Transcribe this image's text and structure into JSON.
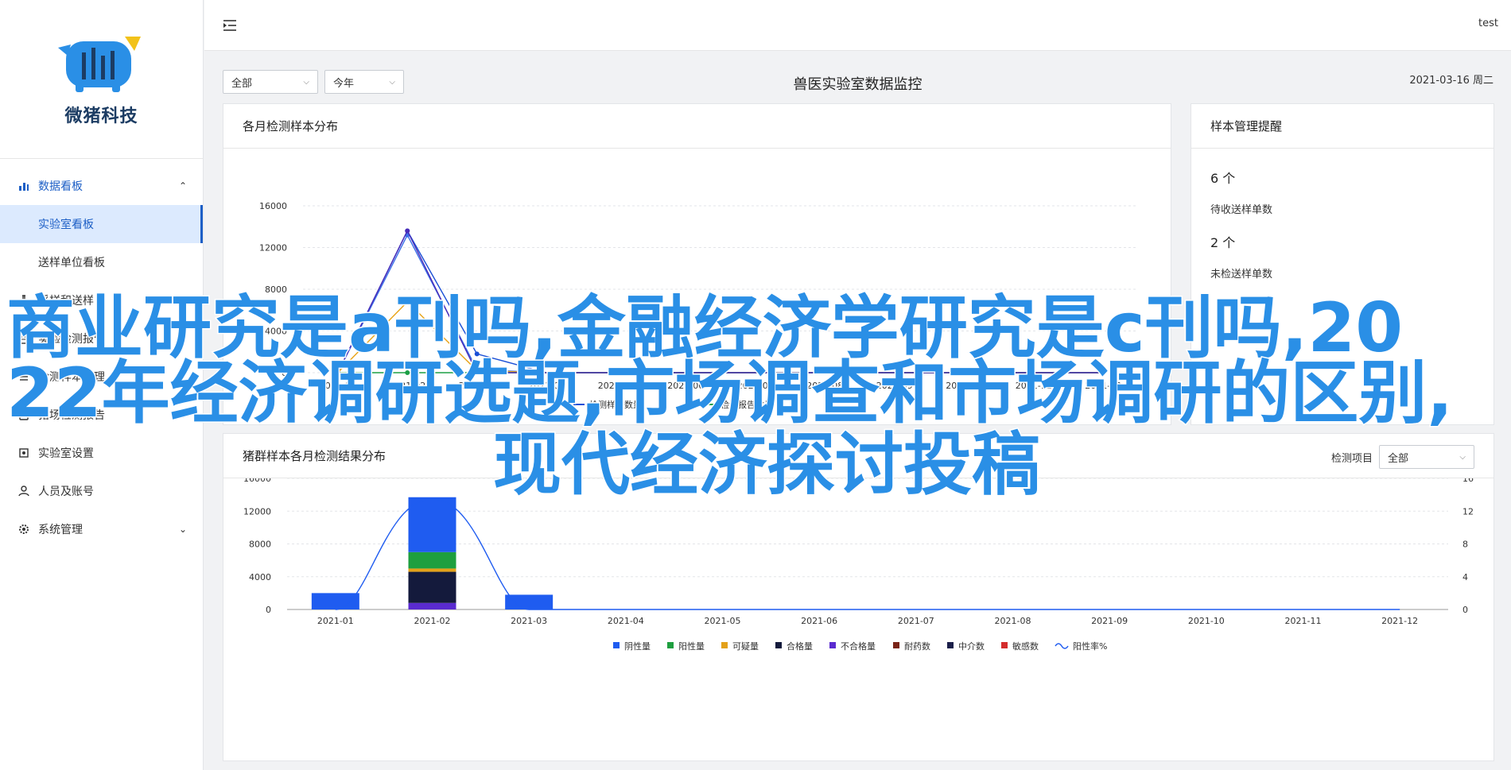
{
  "brand": {
    "name": "微猪科技"
  },
  "sidebar": {
    "items": [
      {
        "label": "数据看板",
        "icon": "bar-chart-icon",
        "expanded": true
      },
      {
        "label": "实验室看板",
        "sub": true,
        "selected": true
      },
      {
        "label": "送样单位看板",
        "sub": true
      },
      {
        "label": "采样和送样",
        "icon": "flask-icon"
      },
      {
        "label": "实验检测报告",
        "icon": "document-icon"
      },
      {
        "label": "检测样本管理",
        "icon": "list-icon"
      },
      {
        "label": "猪场检测报告",
        "icon": "report-icon",
        "chevron": true
      },
      {
        "label": "实验室设置",
        "icon": "gear-icon"
      },
      {
        "label": "人员及账号",
        "icon": "user-icon"
      },
      {
        "label": "系统管理",
        "icon": "settings-icon",
        "chevron": true
      }
    ]
  },
  "topbar": {
    "user": "test"
  },
  "filters": {
    "scope": "全部",
    "period": "今年"
  },
  "page": {
    "title": "兽医实验室数据监控",
    "date": "2021-03-16 周二"
  },
  "card1": {
    "title": "各月检测样本分布"
  },
  "card2": {
    "title": "样本管理提醒",
    "items": [
      {
        "count": "6 个",
        "label": "待收送样单数"
      },
      {
        "count": "2 个",
        "label": "未检送样单数"
      }
    ]
  },
  "card3": {
    "title": "猪群样本各月检测结果分布",
    "filter_label": "检测项目",
    "filter_value": "全部"
  },
  "overlay": {
    "line1": "商业研究是a刊吗,金融经济学研究是c刊吗,20",
    "line2": "22年经济调研选题,市场调查和市场调研的区别,",
    "line3": "现代经济探讨投稿"
  },
  "chart_data": [
    {
      "type": "line",
      "title": "各月检测样本分布",
      "categories": [
        "2021-01",
        "2021-02",
        "2021-03",
        "2021-04",
        "2021-05",
        "2021-06",
        "2021-07",
        "2021-08",
        "2021-09",
        "2021-10",
        "2021-11",
        "2021-12"
      ],
      "ylim": [
        0,
        16000
      ],
      "yticks": [
        "0",
        "4000",
        "8000",
        "12000",
        "16000"
      ],
      "legend_visible": [
        "检测样本数量",
        "检测报告数量"
      ],
      "series": [
        {
          "name": "检测样本数量",
          "color": "#1a4fd6",
          "values": [
            0,
            13600,
            1800,
            0,
            0,
            0,
            0,
            0,
            0,
            0,
            0,
            0
          ]
        },
        {
          "color": "#3a6fe8",
          "values": [
            0,
            13200,
            300,
            0,
            0,
            0,
            0,
            0,
            0,
            0,
            0,
            0
          ]
        },
        {
          "color": "#e8a317",
          "values": [
            0,
            6800,
            200,
            0,
            0,
            0,
            0,
            0,
            0,
            0,
            0,
            0
          ]
        },
        {
          "name": "检测报告数量",
          "color": "#1c9f45",
          "values": [
            0,
            0,
            0,
            0,
            0,
            0,
            0,
            0,
            0,
            0,
            0,
            0
          ]
        },
        {
          "color": "#4a2bb8",
          "values": [
            0,
            13600,
            0,
            0,
            0,
            0,
            0,
            0,
            0,
            0,
            0,
            0
          ]
        }
      ]
    },
    {
      "type": "bar",
      "title": "猪群样本各月检测结果分布",
      "categories": [
        "2021-01",
        "2021-02",
        "2021-03",
        "2021-04",
        "2021-05",
        "2021-06",
        "2021-07",
        "2021-08",
        "2021-09",
        "2021-10",
        "2021-11",
        "2021-12"
      ],
      "ylim": [
        0,
        16000
      ],
      "yticks": [
        "0",
        "4000",
        "8000",
        "12000",
        "16000"
      ],
      "y2lim": [
        0,
        16
      ],
      "y2ticks": [
        "0",
        "4",
        "8",
        "12",
        "16"
      ],
      "series": [
        {
          "name": "敏感数",
          "color": "#d42d2d",
          "values": [
            0,
            0,
            0,
            0,
            0,
            0,
            0,
            0,
            0,
            0,
            0,
            0
          ]
        },
        {
          "name": "中介数",
          "color": "#1b1f4a",
          "values": [
            0,
            0,
            0,
            0,
            0,
            0,
            0,
            0,
            0,
            0,
            0,
            0
          ]
        },
        {
          "name": "耐药数",
          "color": "#7a2418",
          "values": [
            0,
            0,
            0,
            0,
            0,
            0,
            0,
            0,
            0,
            0,
            0,
            0
          ]
        },
        {
          "name": "不合格量",
          "color": "#5a2bd0",
          "values": [
            0,
            800,
            0,
            0,
            0,
            0,
            0,
            0,
            0,
            0,
            0,
            0
          ]
        },
        {
          "name": "合格量",
          "color": "#141a3c",
          "values": [
            0,
            3800,
            0,
            0,
            0,
            0,
            0,
            0,
            0,
            0,
            0,
            0
          ]
        },
        {
          "name": "可疑量",
          "color": "#e3a11a",
          "values": [
            0,
            400,
            0,
            0,
            0,
            0,
            0,
            0,
            0,
            0,
            0,
            0
          ]
        },
        {
          "name": "阳性量",
          "color": "#1e9f3f",
          "values": [
            0,
            2000,
            0,
            0,
            0,
            0,
            0,
            0,
            0,
            0,
            0,
            0
          ]
        },
        {
          "name": "阴性量",
          "color": "#1f5cf0",
          "values": [
            2000,
            6700,
            1800,
            0,
            0,
            0,
            0,
            0,
            0,
            0,
            0,
            0
          ]
        }
      ],
      "line": {
        "name": "阳性率%",
        "color": "#1f5cf0",
        "values": [
          0,
          13.5,
          0,
          0,
          0,
          0,
          0,
          0,
          0,
          0,
          0,
          0
        ]
      },
      "legend": [
        "阴性量",
        "阳性量",
        "可疑量",
        "合格量",
        "不合格量",
        "耐药数",
        "中介数",
        "敏感数",
        "阳性率%"
      ]
    }
  ]
}
